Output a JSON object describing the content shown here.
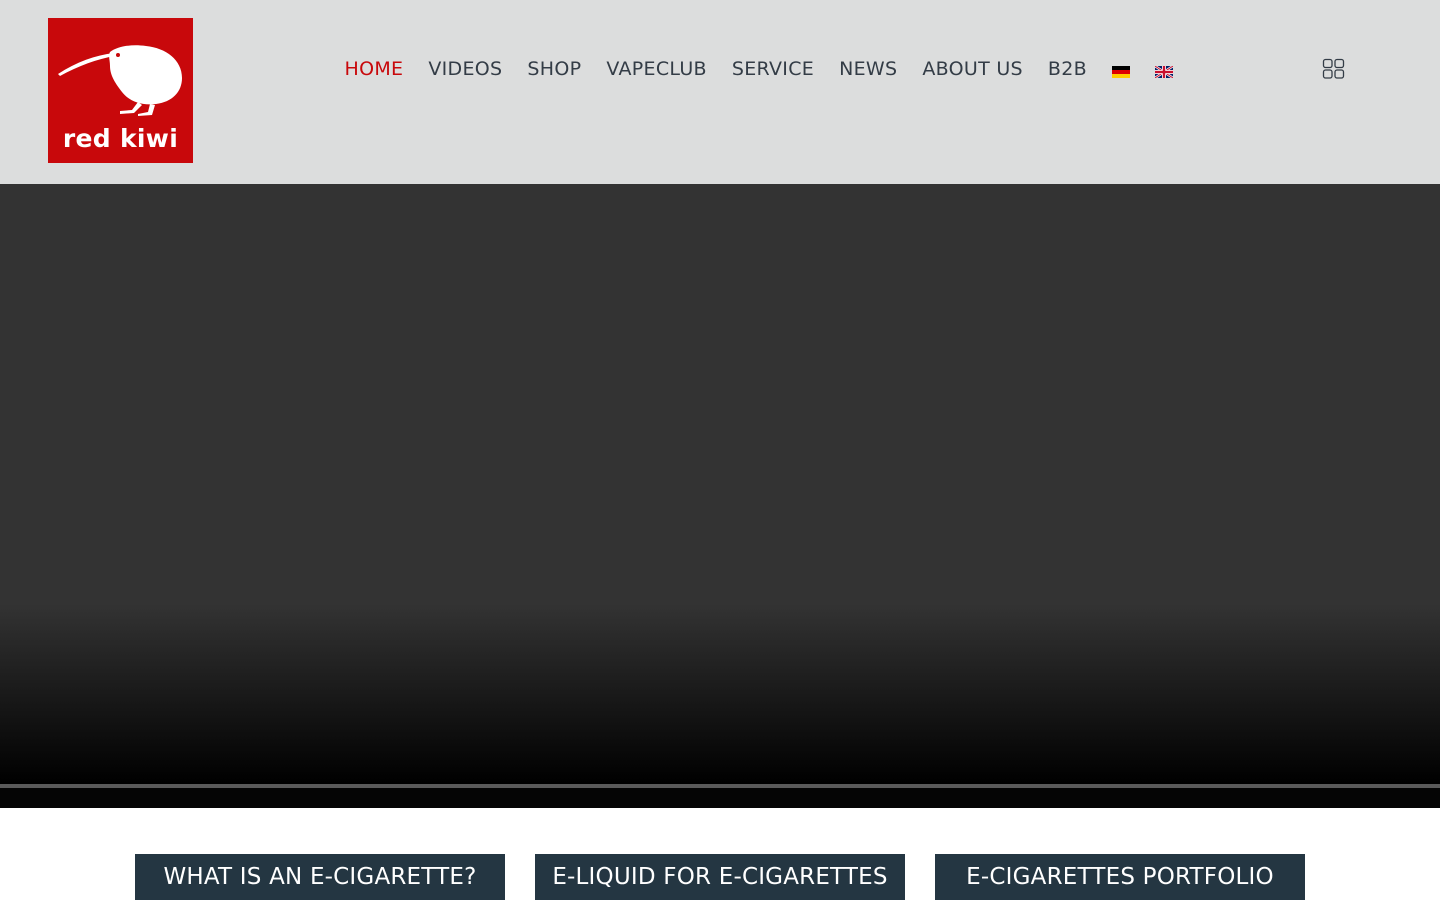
{
  "brand": {
    "logo_text": "red kiwi",
    "logo_icon": "kiwi-bird-icon",
    "color": "#c8080b"
  },
  "nav": {
    "items": [
      {
        "label": "HOME",
        "active": true
      },
      {
        "label": "VIDEOS",
        "active": false
      },
      {
        "label": "SHOP",
        "active": false
      },
      {
        "label": "VAPECLUB",
        "active": false
      },
      {
        "label": "SERVICE",
        "active": false
      },
      {
        "label": "NEWS",
        "active": false
      },
      {
        "label": "ABOUT US",
        "active": false
      },
      {
        "label": "B2B",
        "active": false
      }
    ],
    "languages": [
      "german-flag-icon",
      "uk-flag-icon"
    ],
    "text_color": "#333c46",
    "active_color": "#c8080b"
  },
  "header_tools": {
    "grid_icon": "grid-icon"
  },
  "cards": [
    {
      "label": "WHAT IS AN E-CIGARETTE?"
    },
    {
      "label": "E-LIQUID FOR E-CIGARETTES"
    },
    {
      "label": "E-CIGARETTES PORTFOLIO"
    }
  ],
  "colors": {
    "header_bg": "#dcdddd",
    "hero_bg": "#333333",
    "card_bg": "#243642"
  }
}
